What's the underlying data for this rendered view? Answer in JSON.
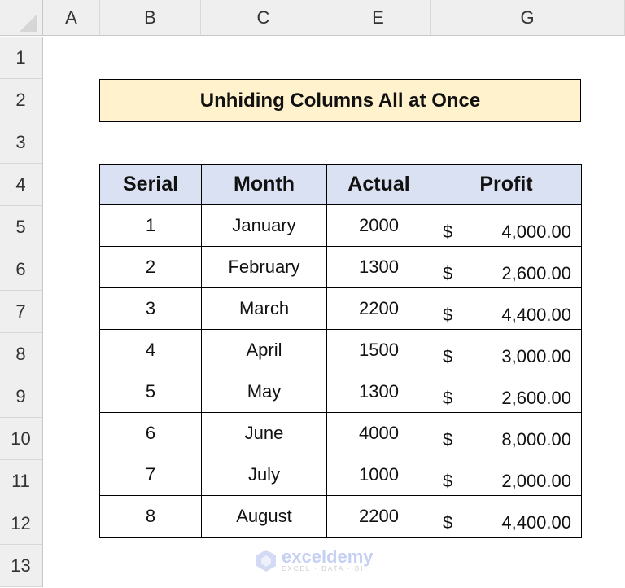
{
  "columns": [
    "A",
    "B",
    "C",
    "E",
    "G"
  ],
  "rows": [
    "1",
    "2",
    "3",
    "4",
    "5",
    "6",
    "7",
    "8",
    "9",
    "10",
    "11",
    "12",
    "13"
  ],
  "title": "Unhiding Columns All at Once",
  "table": {
    "headers": [
      "Serial",
      "Month",
      "Actual",
      "Profit"
    ],
    "rows": [
      {
        "serial": "1",
        "month": "January",
        "actual": "2000",
        "currency": "$",
        "profit": "4,000.00"
      },
      {
        "serial": "2",
        "month": "February",
        "actual": "1300",
        "currency": "$",
        "profit": "2,600.00"
      },
      {
        "serial": "3",
        "month": "March",
        "actual": "2200",
        "currency": "$",
        "profit": "4,400.00"
      },
      {
        "serial": "4",
        "month": "April",
        "actual": "1500",
        "currency": "$",
        "profit": "3,000.00"
      },
      {
        "serial": "5",
        "month": "May",
        "actual": "1300",
        "currency": "$",
        "profit": "2,600.00"
      },
      {
        "serial": "6",
        "month": "June",
        "actual": "4000",
        "currency": "$",
        "profit": "8,000.00"
      },
      {
        "serial": "7",
        "month": "July",
        "actual": "1000",
        "currency": "$",
        "profit": "2,000.00"
      },
      {
        "serial": "8",
        "month": "August",
        "actual": "2200",
        "currency": "$",
        "profit": "4,400.00"
      }
    ]
  },
  "watermark": {
    "name": "exceldemy",
    "tagline": "EXCEL · DATA · BI"
  },
  "colors": {
    "title_fill": "#fff2cc",
    "header_fill": "#d9e1f2"
  }
}
